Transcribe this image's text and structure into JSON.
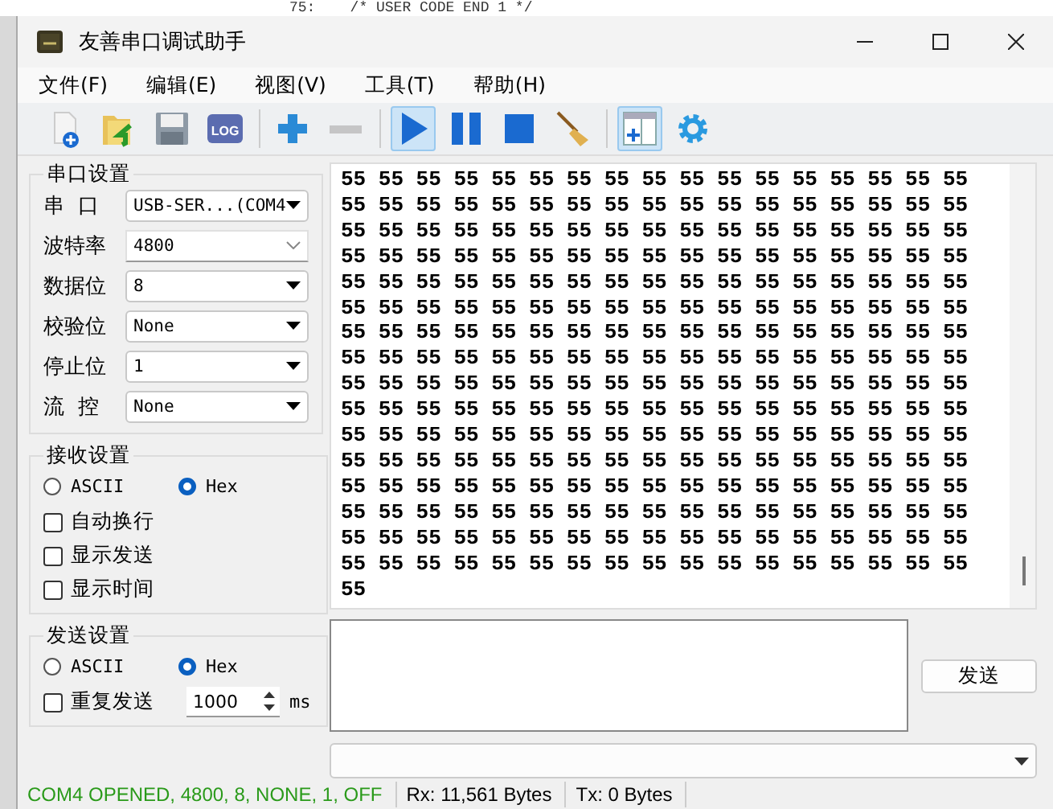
{
  "background_editor": {
    "line": "75:    /* USER CODE END 1 */"
  },
  "window": {
    "title": "友善串口调试助手"
  },
  "menu": [
    "文件(F)",
    "编辑(E)",
    "视图(V)",
    "工具(T)",
    "帮助(H)"
  ],
  "toolbar": [
    {
      "pressed": false,
      "disabled": false
    },
    {
      "pressed": false,
      "disabled": false
    },
    {
      "pressed": false,
      "disabled": false
    },
    {
      "pressed": false,
      "disabled": false,
      "label": "LOG"
    },
    {
      "pressed": false,
      "disabled": false
    },
    {
      "pressed": false,
      "disabled": true
    },
    {
      "pressed": true,
      "disabled": false
    },
    {
      "pressed": false,
      "disabled": false
    },
    {
      "pressed": false,
      "disabled": false
    },
    {
      "pressed": false,
      "disabled": false
    },
    {
      "pressed": true,
      "disabled": false
    },
    {
      "pressed": false,
      "disabled": false
    }
  ],
  "serial_settings": {
    "title": "串口设置",
    "fields": [
      {
        "label": "串  口",
        "value": "USB-SER...(COM4",
        "kind": "dropdown"
      },
      {
        "label": "波特率",
        "value": "4800",
        "kind": "editable"
      },
      {
        "label": "数据位",
        "value": "8",
        "kind": "dropdown"
      },
      {
        "label": "校验位",
        "value": "None",
        "kind": "dropdown"
      },
      {
        "label": "停止位",
        "value": "1",
        "kind": "dropdown"
      },
      {
        "label": "流  控",
        "value": "None",
        "kind": "dropdown"
      }
    ]
  },
  "receive_settings": {
    "title": "接收设置",
    "modes": [
      {
        "label": "ASCII",
        "selected": false
      },
      {
        "label": "Hex",
        "selected": true
      }
    ],
    "options": [
      {
        "label": "自动换行",
        "checked": false
      },
      {
        "label": "显示发送",
        "checked": false
      },
      {
        "label": "显示时间",
        "checked": false
      }
    ]
  },
  "send_settings": {
    "title": "发送设置",
    "modes": [
      {
        "label": "ASCII",
        "selected": false
      },
      {
        "label": "Hex",
        "selected": true
      }
    ],
    "repeat": {
      "label": "重复发送",
      "checked": false,
      "value": "1000",
      "unit": "ms"
    }
  },
  "receive_area": {
    "lines": [
      "55 55 55 55 55 55 55 55 55 55 55 55 55 55 55 55 55",
      "55 55 55 55 55 55 55 55 55 55 55 55 55 55 55 55 55",
      "55 55 55 55 55 55 55 55 55 55 55 55 55 55 55 55 55",
      "55 55 55 55 55 55 55 55 55 55 55 55 55 55 55 55 55",
      "55 55 55 55 55 55 55 55 55 55 55 55 55 55 55 55 55",
      "55 55 55 55 55 55 55 55 55 55 55 55 55 55 55 55 55",
      "55 55 55 55 55 55 55 55 55 55 55 55 55 55 55 55 55",
      "55 55 55 55 55 55 55 55 55 55 55 55 55 55 55 55 55",
      "55 55 55 55 55 55 55 55 55 55 55 55 55 55 55 55 55",
      "55 55 55 55 55 55 55 55 55 55 55 55 55 55 55 55 55",
      "55 55 55 55 55 55 55 55 55 55 55 55 55 55 55 55 55",
      "55 55 55 55 55 55 55 55 55 55 55 55 55 55 55 55 55",
      "55 55 55 55 55 55 55 55 55 55 55 55 55 55 55 55 55",
      "55 55 55 55 55 55 55 55 55 55 55 55 55 55 55 55 55",
      "55 55 55 55 55 55 55 55 55 55 55 55 55 55 55 55 55",
      "55 55 55 55 55 55 55 55 55 55 55 55 55 55 55 55 55",
      "55"
    ]
  },
  "send_button": "发送",
  "status_bar": [
    {
      "text": "COM4 OPENED, 4800, 8, NONE, 1, OFF",
      "color": "#2a9a1a"
    },
    {
      "text": "Rx: 11,561 Bytes",
      "color": "#000000"
    },
    {
      "text": "Tx: 0 Bytes",
      "color": "#000000"
    }
  ]
}
